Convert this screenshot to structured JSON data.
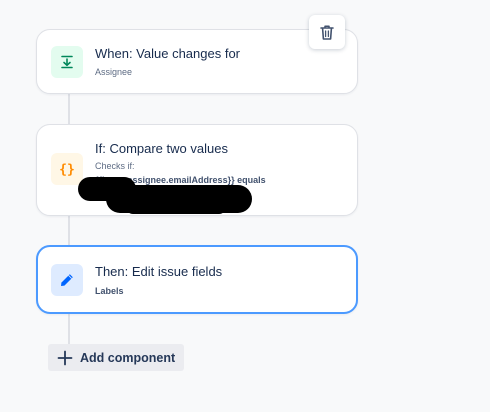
{
  "rules": [
    {
      "title": "When: Value changes for",
      "subtitle": "Assignee",
      "icon": "trigger-field-icon",
      "icon_color": "#00875a",
      "icon_bg": "#e3fcef"
    },
    {
      "title": "If: Compare two values",
      "subtitle": "Checks if:",
      "detail": "{{issue.assignee.emailAddress}} equals",
      "icon": "braces-icon",
      "icon_color": "#ff8b00",
      "icon_bg": "#fff7e6"
    },
    {
      "title": "Then: Edit issue fields",
      "subtitle": "Labels",
      "icon": "pencil-icon",
      "icon_color": "#0065ff",
      "icon_bg": "#deebff"
    }
  ],
  "delete_icon": "trash-icon",
  "add_component": {
    "label": "Add component",
    "icon": "plus-icon"
  },
  "colors": {
    "selected_border": "#4c9aff",
    "background": "#f8f9fa"
  }
}
